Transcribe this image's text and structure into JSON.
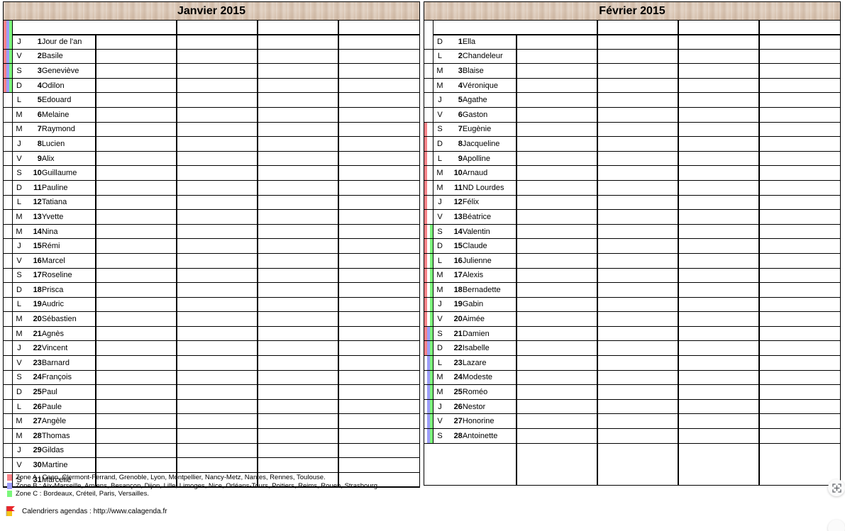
{
  "colors": {
    "zone_a": "#f98287",
    "zone_b": "#9d9dfb",
    "zone_c": "#7bf77b",
    "header_bg": "#d9c6b5",
    "grid_line": "#000000"
  },
  "months": [
    {
      "title": "Janvier 2015",
      "note_columns": 4,
      "days": [
        {
          "letter": "J",
          "num": "1",
          "saint": "Jour de l'an",
          "zones": [
            "A",
            "B",
            "C"
          ]
        },
        {
          "letter": "V",
          "num": "2",
          "saint": "Basile",
          "zones": [
            "A",
            "B",
            "C"
          ]
        },
        {
          "letter": "S",
          "num": "3",
          "saint": "Geneviève",
          "zones": [
            "A",
            "B",
            "C"
          ]
        },
        {
          "letter": "D",
          "num": "4",
          "saint": "Odilon",
          "zones": [
            "A",
            "B",
            "C"
          ]
        },
        {
          "letter": "L",
          "num": "5",
          "saint": "Edouard",
          "zones": []
        },
        {
          "letter": "M",
          "num": "6",
          "saint": "Melaine",
          "zones": []
        },
        {
          "letter": "M",
          "num": "7",
          "saint": "Raymond",
          "zones": []
        },
        {
          "letter": "J",
          "num": "8",
          "saint": "Lucien",
          "zones": []
        },
        {
          "letter": "V",
          "num": "9",
          "saint": "Alix",
          "zones": []
        },
        {
          "letter": "S",
          "num": "10",
          "saint": "Guillaume",
          "zones": []
        },
        {
          "letter": "D",
          "num": "11",
          "saint": "Pauline",
          "zones": []
        },
        {
          "letter": "L",
          "num": "12",
          "saint": "Tatiana",
          "zones": []
        },
        {
          "letter": "M",
          "num": "13",
          "saint": "Yvette",
          "zones": []
        },
        {
          "letter": "M",
          "num": "14",
          "saint": "Nina",
          "zones": []
        },
        {
          "letter": "J",
          "num": "15",
          "saint": "Rémi",
          "zones": []
        },
        {
          "letter": "V",
          "num": "16",
          "saint": "Marcel",
          "zones": []
        },
        {
          "letter": "S",
          "num": "17",
          "saint": "Roseline",
          "zones": []
        },
        {
          "letter": "D",
          "num": "18",
          "saint": "Prisca",
          "zones": []
        },
        {
          "letter": "L",
          "num": "19",
          "saint": "Audric",
          "zones": []
        },
        {
          "letter": "M",
          "num": "20",
          "saint": "Sébastien",
          "zones": []
        },
        {
          "letter": "M",
          "num": "21",
          "saint": "Agnès",
          "zones": []
        },
        {
          "letter": "J",
          "num": "22",
          "saint": "Vincent",
          "zones": []
        },
        {
          "letter": "V",
          "num": "23",
          "saint": "Barnard",
          "zones": []
        },
        {
          "letter": "S",
          "num": "24",
          "saint": "François",
          "zones": []
        },
        {
          "letter": "D",
          "num": "25",
          "saint": "Paul",
          "zones": []
        },
        {
          "letter": "L",
          "num": "26",
          "saint": "Paule",
          "zones": []
        },
        {
          "letter": "M",
          "num": "27",
          "saint": "Angèle",
          "zones": []
        },
        {
          "letter": "M",
          "num": "28",
          "saint": "Thomas",
          "zones": []
        },
        {
          "letter": "J",
          "num": "29",
          "saint": "Gildas",
          "zones": []
        },
        {
          "letter": "V",
          "num": "30",
          "saint": "Martine",
          "zones": []
        },
        {
          "letter": "S",
          "num": "31",
          "saint": "Marcelle",
          "zones": []
        }
      ]
    },
    {
      "title": "Février 2015",
      "note_columns": 4,
      "days": [
        {
          "letter": "D",
          "num": "1",
          "saint": "Ella",
          "zones": []
        },
        {
          "letter": "L",
          "num": "2",
          "saint": "Chandeleur",
          "zones": []
        },
        {
          "letter": "M",
          "num": "3",
          "saint": "Blaise",
          "zones": []
        },
        {
          "letter": "M",
          "num": "4",
          "saint": "Véronique",
          "zones": []
        },
        {
          "letter": "J",
          "num": "5",
          "saint": "Agathe",
          "zones": []
        },
        {
          "letter": "V",
          "num": "6",
          "saint": "Gaston",
          "zones": []
        },
        {
          "letter": "S",
          "num": "7",
          "saint": "Eugènie",
          "zones": [
            "A"
          ]
        },
        {
          "letter": "D",
          "num": "8",
          "saint": "Jacqueline",
          "zones": [
            "A"
          ]
        },
        {
          "letter": "L",
          "num": "9",
          "saint": "Apolline",
          "zones": [
            "A"
          ]
        },
        {
          "letter": "M",
          "num": "10",
          "saint": "Arnaud",
          "zones": [
            "A"
          ]
        },
        {
          "letter": "M",
          "num": "11",
          "saint": "ND Lourdes",
          "zones": [
            "A"
          ]
        },
        {
          "letter": "J",
          "num": "12",
          "saint": "Félix",
          "zones": [
            "A"
          ]
        },
        {
          "letter": "V",
          "num": "13",
          "saint": "Béatrice",
          "zones": [
            "A"
          ]
        },
        {
          "letter": "S",
          "num": "14",
          "saint": "Valentin",
          "zones": [
            "A",
            "C"
          ]
        },
        {
          "letter": "D",
          "num": "15",
          "saint": "Claude",
          "zones": [
            "A",
            "C"
          ]
        },
        {
          "letter": "L",
          "num": "16",
          "saint": "Julienne",
          "zones": [
            "A",
            "C"
          ]
        },
        {
          "letter": "M",
          "num": "17",
          "saint": "Alexis",
          "zones": [
            "A",
            "C"
          ]
        },
        {
          "letter": "M",
          "num": "18",
          "saint": "Bernadette",
          "zones": [
            "A",
            "C"
          ]
        },
        {
          "letter": "J",
          "num": "19",
          "saint": "Gabin",
          "zones": [
            "A",
            "C"
          ]
        },
        {
          "letter": "V",
          "num": "20",
          "saint": "Aimée",
          "zones": [
            "A",
            "C"
          ]
        },
        {
          "letter": "S",
          "num": "21",
          "saint": "Damien",
          "zones": [
            "A",
            "B",
            "C"
          ]
        },
        {
          "letter": "D",
          "num": "22",
          "saint": "Isabelle",
          "zones": [
            "A",
            "B",
            "C"
          ]
        },
        {
          "letter": "L",
          "num": "23",
          "saint": "Lazare",
          "zones": [
            "B",
            "C"
          ]
        },
        {
          "letter": "M",
          "num": "24",
          "saint": "Modeste",
          "zones": [
            "B",
            "C"
          ]
        },
        {
          "letter": "M",
          "num": "25",
          "saint": "Roméo",
          "zones": [
            "B",
            "C"
          ]
        },
        {
          "letter": "J",
          "num": "26",
          "saint": "Nestor",
          "zones": [
            "B",
            "C"
          ]
        },
        {
          "letter": "V",
          "num": "27",
          "saint": "Honorine",
          "zones": [
            "B",
            "C"
          ]
        },
        {
          "letter": "S",
          "num": "28",
          "saint": "Antoinette",
          "zones": [
            "B",
            "C"
          ]
        }
      ]
    }
  ],
  "legend": [
    {
      "zone": "A",
      "color": "#f98287",
      "text": "Zone A : Caen, Clermont-Ferrand, Grenoble, Lyon, Montpellier, Nancy-Metz, Nantes, Rennes, Toulouse."
    },
    {
      "zone": "B",
      "color": "#9d9dfb",
      "text": "Zone B : Aix-Marseille, Amiens, Besançon, Dijon, Lille, Limoges, Nice, Orléans-Tours, Poitiers, Reims, Rouen, Strasbourg."
    },
    {
      "zone": "C",
      "color": "#7bf77b",
      "text": "Zone C : Bordeaux, Créteil, Paris, Versailles."
    }
  ],
  "credit": {
    "text": "Calendriers agendas : http://www.calagenda.fr"
  }
}
